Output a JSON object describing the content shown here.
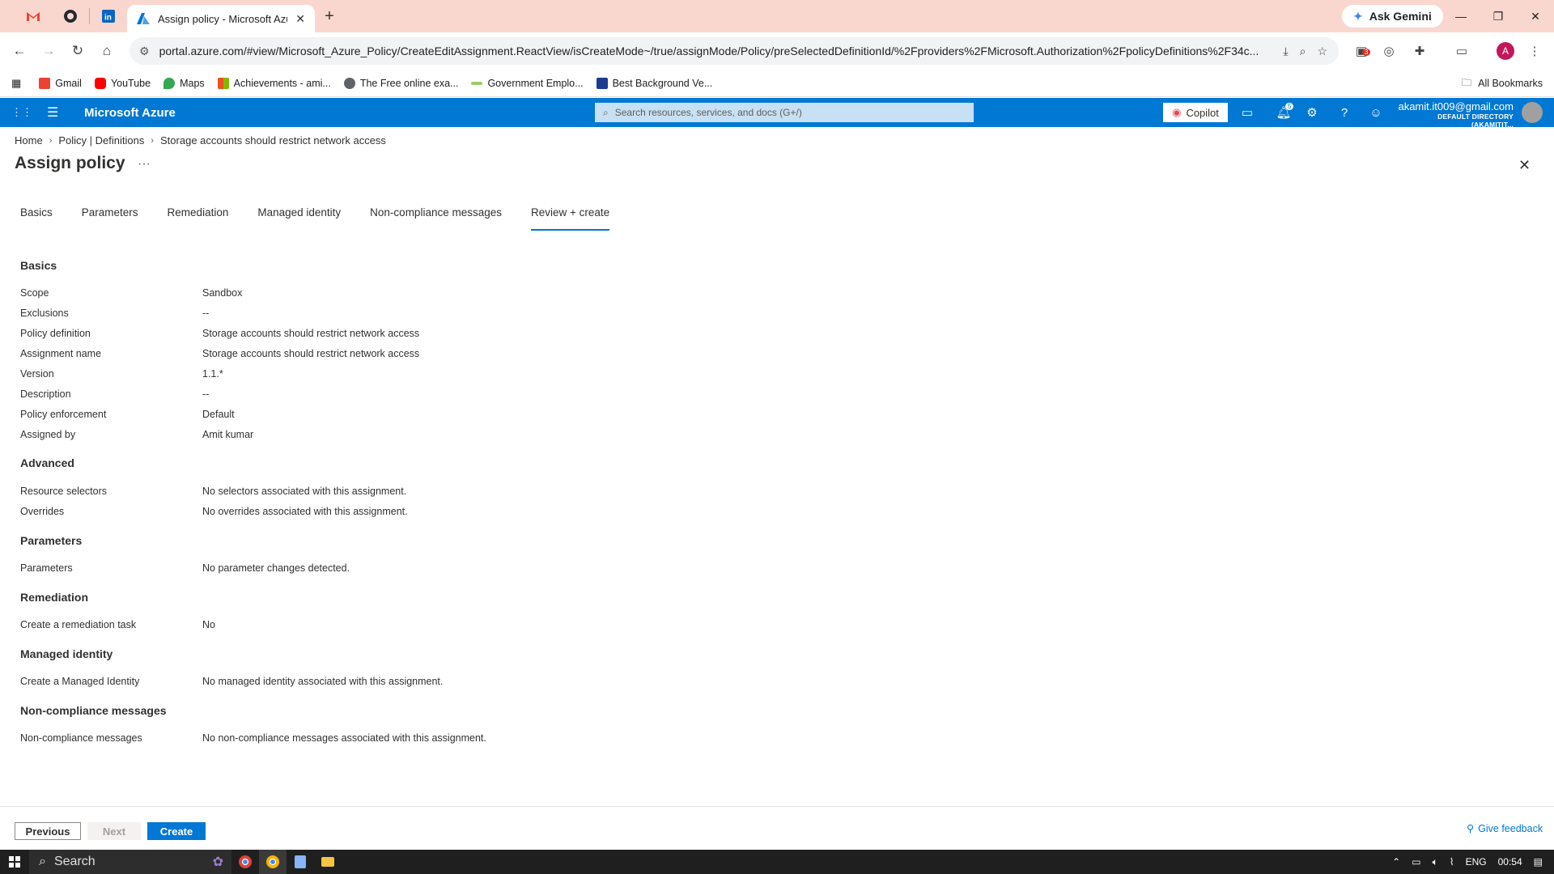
{
  "browser": {
    "tab_title": "Assign policy - Microsoft Azure",
    "gemini_label": "Ask Gemini",
    "url": "portal.azure.com/#view/Microsoft_Azure_Policy/CreateEditAssignment.ReactView/isCreateMode~/true/assignMode/Policy/preSelectedDefinitionId/%2Fproviders%2FMicrosoft.Authorization%2FpolicyDefinitions%2F34c...",
    "extension_badge": "3",
    "profile_initial": "A",
    "bookmarks": [
      "Gmail",
      "YouTube",
      "Maps",
      "Achievements - ami...",
      "The Free online exa...",
      "Government Emplo...",
      "Best Background Ve..."
    ],
    "all_bookmarks": "All Bookmarks"
  },
  "azure": {
    "brand": "Microsoft Azure",
    "search_placeholder": "Search resources, services, and docs (G+/)",
    "copilot": "Copilot",
    "notifications_count": "5",
    "user_email": "akamit.it009@gmail.com",
    "user_directory": "DEFAULT DIRECTORY (AKAMITIT..."
  },
  "breadcrumb": [
    "Home",
    "Policy | Definitions",
    "Storage accounts should restrict network access"
  ],
  "page_title": "Assign policy",
  "tabs": [
    "Basics",
    "Parameters",
    "Remediation",
    "Managed identity",
    "Non-compliance messages",
    "Review + create"
  ],
  "sections": {
    "basics": {
      "heading": "Basics",
      "rows": [
        {
          "label": "Scope",
          "value": "Sandbox"
        },
        {
          "label": "Exclusions",
          "value": "--"
        },
        {
          "label": "Policy definition",
          "value": "Storage accounts should restrict network access"
        },
        {
          "label": "Assignment name",
          "value": "Storage accounts should restrict network access"
        },
        {
          "label": "Version",
          "value": "1.1.*"
        },
        {
          "label": "Description",
          "value": "--"
        },
        {
          "label": "Policy enforcement",
          "value": "Default"
        },
        {
          "label": "Assigned by",
          "value": "Amit kumar"
        }
      ]
    },
    "advanced": {
      "heading": "Advanced",
      "rows": [
        {
          "label": "Resource selectors",
          "value": "No selectors associated with this assignment."
        },
        {
          "label": "Overrides",
          "value": "No overrides associated with this assignment."
        }
      ]
    },
    "parameters": {
      "heading": "Parameters",
      "rows": [
        {
          "label": "Parameters",
          "value": "No parameter changes detected."
        }
      ]
    },
    "remediation": {
      "heading": "Remediation",
      "rows": [
        {
          "label": "Create a remediation task",
          "value": "No"
        }
      ]
    },
    "managed_identity": {
      "heading": "Managed identity",
      "rows": [
        {
          "label": "Create a Managed Identity",
          "value": "No managed identity associated with this assignment."
        }
      ]
    },
    "noncompliance": {
      "heading": "Non-compliance messages",
      "rows": [
        {
          "label": "Non-compliance messages",
          "value": "No non-compliance messages associated with this assignment."
        }
      ]
    }
  },
  "footer": {
    "previous": "Previous",
    "next": "Next",
    "create": "Create",
    "feedback": "Give feedback"
  },
  "taskbar": {
    "search_label": "Search",
    "language": "ENG",
    "time": "00:54"
  },
  "colors": {
    "accent": "#0078d4",
    "tabstrip": "#f9d7cf"
  }
}
